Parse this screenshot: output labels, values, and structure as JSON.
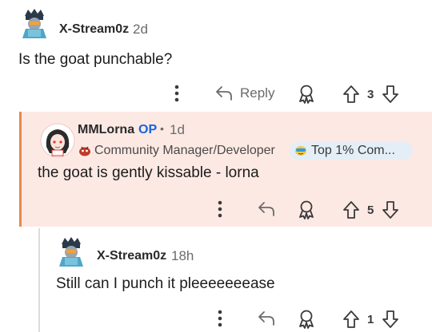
{
  "comments": [
    {
      "username": "X-Stream0z",
      "age": "2d",
      "body": "Is the goat punchable?",
      "reply_label": "Reply",
      "upvotes": "3"
    },
    {
      "username": "MMLorna",
      "op_tag": "OP",
      "separator": "•",
      "age": "1d",
      "flair": "Community Manager/Developer",
      "badge": "Top 1% Com...",
      "body": "the goat is gently kissable - lorna",
      "upvotes": "5"
    },
    {
      "username": "X-Stream0z",
      "age": "18h",
      "body": "Still can I punch it pleeeeeeease",
      "upvotes": "1"
    }
  ],
  "colors": {
    "op_highlight": "#fde9e4",
    "op_border": "#e8884f",
    "op_tag": "#1565d8",
    "badge_bg": "#e4eef6"
  },
  "icons": [
    "more-options-icon",
    "reply-arrow-icon",
    "award-icon",
    "upvote-arrow-icon",
    "downvote-arrow-icon",
    "flair-emoji-icon",
    "badge-icon"
  ]
}
